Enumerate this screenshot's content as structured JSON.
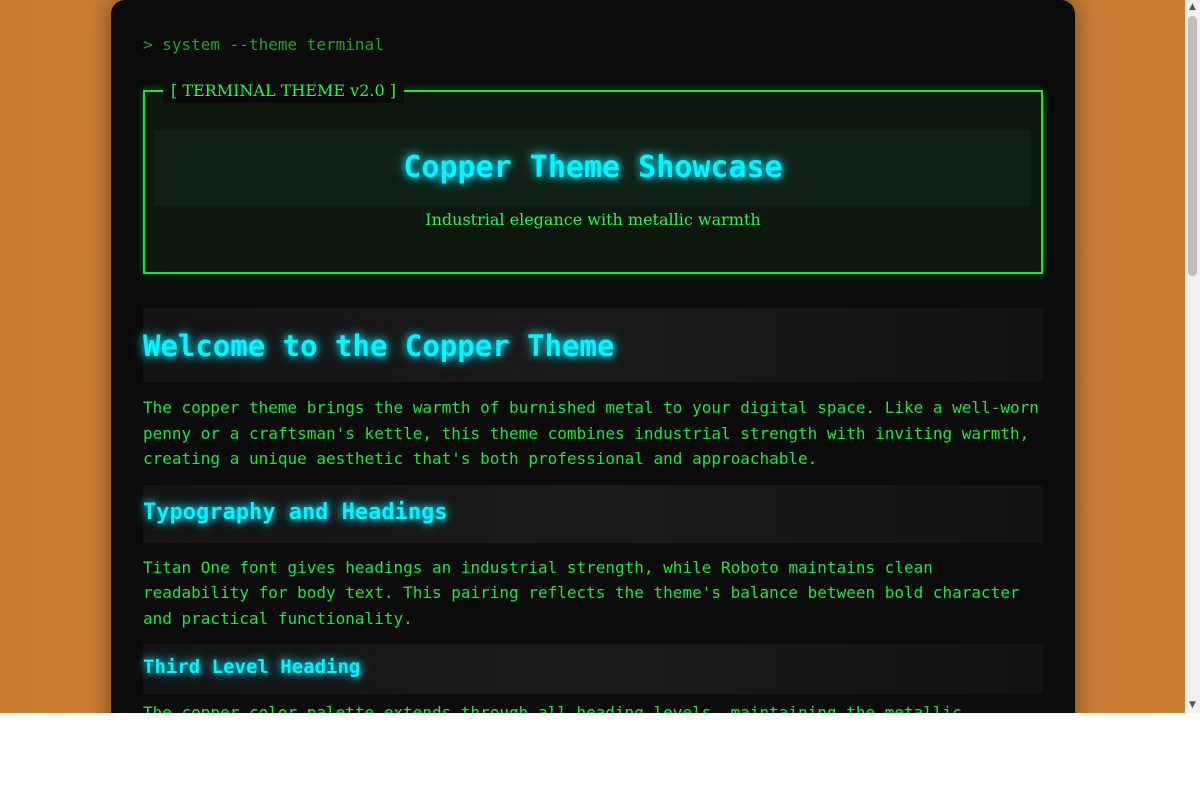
{
  "prompt": "> system --theme terminal",
  "header": {
    "legend": "[ TERMINAL THEME v2.0 ]",
    "title": "Copper Theme Showcase",
    "subtitle": "Industrial elegance with metallic warmth"
  },
  "sections": {
    "h1": "Welcome to the Copper Theme",
    "p1": "The copper theme brings the warmth of burnished metal to your digital space. Like a well-worn penny or a craftsman's kettle, this theme combines industrial strength with inviting warmth, creating a unique aesthetic that's both professional and approachable.",
    "h2": "Typography and Headings",
    "p2": "Titan One font gives headings an industrial strength, while Roboto maintains clean readability for body text. This pairing reflects the theme's balance between bold character and practical functionality.",
    "h3": "Third Level Heading",
    "p3": "The copper color palette extends through all heading levels, maintaining the metallic aesthetic while providing clear visual hierarchy."
  },
  "scrollbar": {
    "up_icon": "▲",
    "down_icon": "▼"
  },
  "colors": {
    "page_background": "#cc7f36",
    "terminal_background": "#0b0b0b",
    "accent_green": "#18e83a",
    "heading_cyan": "#00f7ff"
  }
}
